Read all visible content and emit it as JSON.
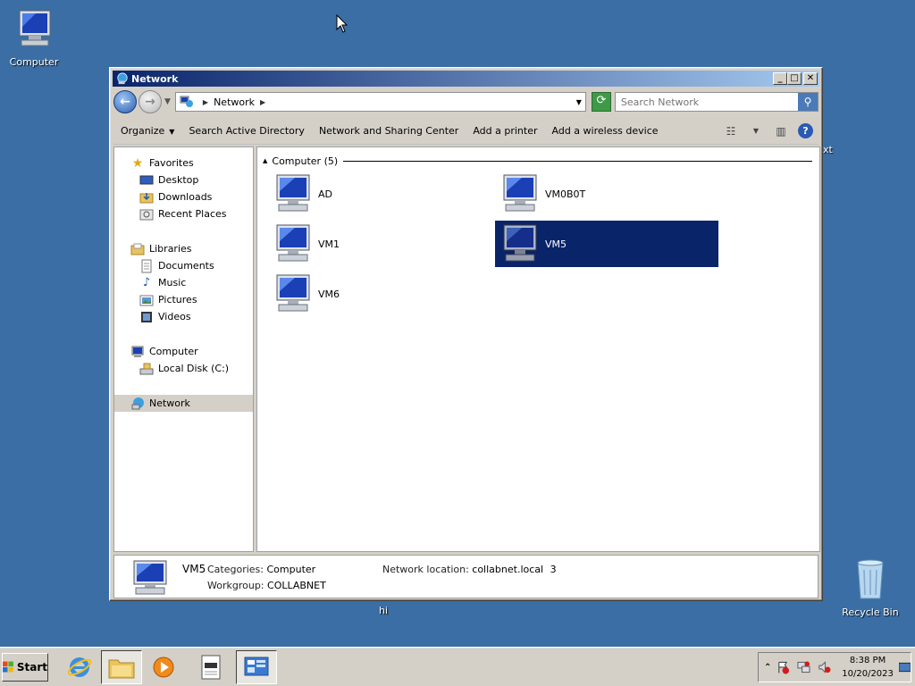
{
  "desktop": {
    "computer_label": "Computer",
    "recycle_label": "Recycle Bin",
    "stray_text_1": "xt",
    "stray_text_2": "hi"
  },
  "window": {
    "title": "Network",
    "minimize_glyph": "_",
    "maximize_glyph": "□",
    "close_glyph": "✕"
  },
  "address": {
    "crumb": "Network",
    "search_placeholder": "Search Network"
  },
  "toolbar": {
    "organize": "Organize",
    "search_ad": "Search Active Directory",
    "sharing_center": "Network and Sharing Center",
    "add_printer": "Add a printer",
    "add_wireless": "Add a wireless device"
  },
  "navpane": {
    "favorites": "Favorites",
    "desktop": "Desktop",
    "downloads": "Downloads",
    "recent_places": "Recent Places",
    "libraries": "Libraries",
    "documents": "Documents",
    "music": "Music",
    "pictures": "Pictures",
    "videos": "Videos",
    "computer": "Computer",
    "local_disk": "Local Disk (C:)",
    "network": "Network"
  },
  "content": {
    "group_header": "Computer (5)",
    "items": [
      "AD",
      "VM0B0T",
      "VM1",
      "VM5",
      "VM6"
    ],
    "selected": "VM5"
  },
  "details": {
    "name": "VM5",
    "categories_label": "Categories:",
    "categories_value": "Computer",
    "workgroup_label": "Workgroup:",
    "workgroup_value": "COLLABNET",
    "location_label": "Network location:",
    "location_value": "collabnet.local",
    "location_count": "3"
  },
  "taskbar": {
    "start_label": "Start",
    "time": "8:38 PM",
    "date": "10/20/2023"
  },
  "colors": {
    "desktop_bg": "#3a6ea5",
    "selection": "#0a246a",
    "titlebar_start": "#0a246a"
  }
}
